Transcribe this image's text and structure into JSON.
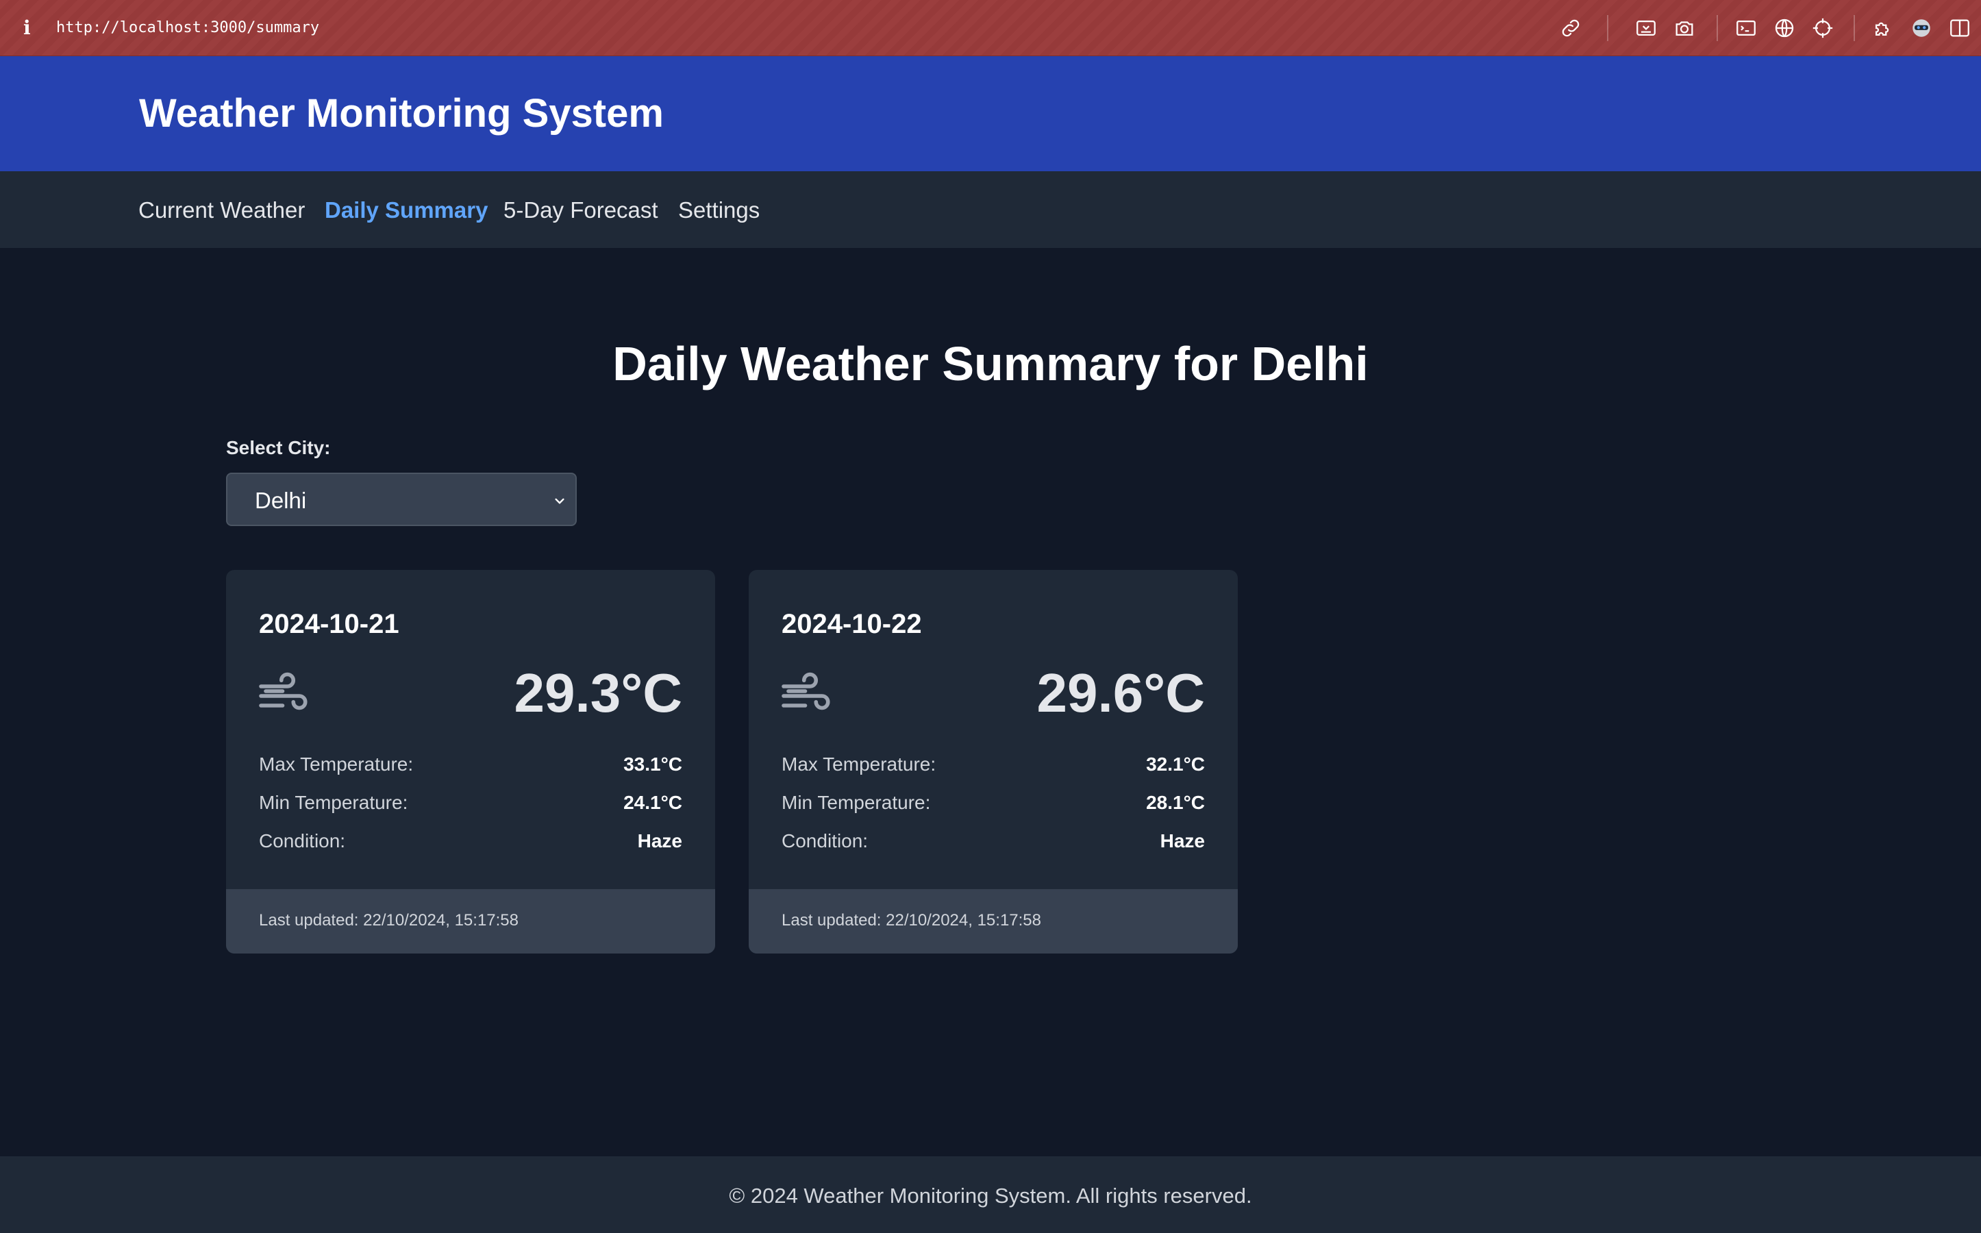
{
  "browser": {
    "url": "http://localhost:3000/summary",
    "info_icon": "i",
    "toolbar_icons": [
      "link-icon",
      "screenshot-area-icon",
      "camera-icon",
      "terminal-icon",
      "globe-icon",
      "crosshair-icon",
      "extensions-icon",
      "profile-icon",
      "sidebar-icon"
    ]
  },
  "header": {
    "title": "Weather Monitoring System"
  },
  "nav": {
    "items": [
      {
        "label": "Current Weather",
        "active": false
      },
      {
        "label": "Daily Summary",
        "active": true
      },
      {
        "label": "5-Day Forecast",
        "active": false
      },
      {
        "label": "Settings",
        "active": false
      }
    ]
  },
  "main": {
    "heading": "Daily Weather Summary for Delhi",
    "select_label": "Select City:",
    "selected_city": "Delhi",
    "cards": [
      {
        "date": "2024-10-21",
        "icon": "wind-icon",
        "temp": "29.3°C",
        "rows": [
          {
            "label": "Max Temperature:",
            "value": "33.1°C"
          },
          {
            "label": "Min Temperature:",
            "value": "24.1°C"
          },
          {
            "label": "Condition:",
            "value": "Haze"
          }
        ],
        "updated": "Last updated: 22/10/2024, 15:17:58"
      },
      {
        "date": "2024-10-22",
        "icon": "wind-icon",
        "temp": "29.6°C",
        "rows": [
          {
            "label": "Max Temperature:",
            "value": "32.1°C"
          },
          {
            "label": "Min Temperature:",
            "value": "28.1°C"
          },
          {
            "label": "Condition:",
            "value": "Haze"
          }
        ],
        "updated": "Last updated: 22/10/2024, 15:17:58"
      }
    ]
  },
  "footer": {
    "text": "© 2024 Weather Monitoring System. All rights reserved."
  },
  "colors": {
    "header_bg": "#2642b0",
    "nav_bg": "#1f2937",
    "page_bg": "#111827",
    "active_link": "#60a5fa",
    "browser_bar": "#9b3e3e"
  }
}
